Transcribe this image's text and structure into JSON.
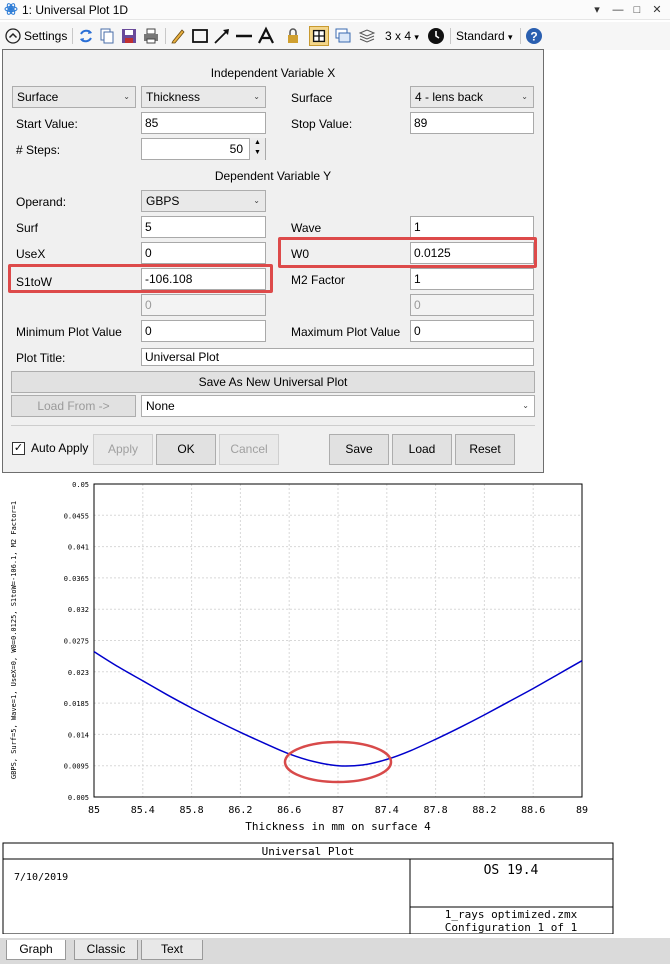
{
  "window": {
    "title": "1: Universal Plot 1D"
  },
  "toolbar": {
    "settings_label": "Settings",
    "layout_label": "3 x 4",
    "layout_caret": "▾",
    "standard_label": "Standard",
    "standard_caret": "▾"
  },
  "settings": {
    "section_x": "Independent Variable X",
    "x_type_combo": "Surface",
    "x_param_combo": "Thickness",
    "surface_label": "Surface",
    "surface_combo": "4 - lens back",
    "start_label": "Start Value:",
    "start_value": "85",
    "stop_label": "Stop Value:",
    "stop_value": "89",
    "steps_label": "# Steps:",
    "steps_value": "50",
    "section_y": "Dependent Variable Y",
    "operand_label": "Operand:",
    "operand_combo": "GBPS",
    "surf_label": "Surf",
    "surf_value": "5",
    "wave_label": "Wave",
    "wave_value": "1",
    "usex_label": "UseX",
    "usex_value": "0",
    "w0_label": "W0",
    "w0_value": "0.0125",
    "s1tow_label": "S1toW",
    "s1tow_value": "-106.108",
    "m2_label": "M2 Factor",
    "m2_value": "1",
    "extra_left_value": "0",
    "extra_right_value": "0",
    "min_label": "Minimum Plot Value",
    "min_value": "0",
    "max_label": "Maximum Plot Value",
    "max_value": "0",
    "plot_title_label": "Plot Title:",
    "plot_title_value": "Universal Plot",
    "save_as_new": "Save As New Universal Plot",
    "load_from": "Load From ->",
    "load_combo": "None",
    "auto_apply_label": "Auto Apply",
    "auto_apply_checked": "✓",
    "apply_button": "Apply",
    "ok_button": "OK",
    "cancel_button": "Cancel",
    "save_button": "Save",
    "load_button": "Load",
    "reset_button": "Reset"
  },
  "chart_data": {
    "type": "line",
    "xlabel": "Thickness in mm on surface 4",
    "ylabel": "GBPS, Surf=5, Wave=1, UseX=0, W0=0.0125, S1toW=-106.1, M2 Factor=1",
    "xlim": [
      85,
      89
    ],
    "ylim": [
      0.005,
      0.05
    ],
    "x_ticks": [
      "85",
      "85.4",
      "85.8",
      "86.2",
      "86.6",
      "87",
      "87.4",
      "87.8",
      "88.2",
      "88.6",
      "89"
    ],
    "y_ticks": [
      "0.005",
      "0.0095",
      "0.014",
      "0.0185",
      "0.023",
      "0.0275",
      "0.032",
      "0.0365",
      "0.041",
      "0.0455",
      "0.05"
    ],
    "grid": true,
    "line_color": "#0000cc",
    "annotation_color": "#d84a4a",
    "series": [
      {
        "x": [
          85,
          85.2,
          85.4,
          85.6,
          85.8,
          86.0,
          86.2,
          86.4,
          86.6,
          86.8,
          87.0,
          87.2,
          87.4,
          87.6,
          87.8,
          88.0,
          88.2,
          88.4,
          88.6,
          88.8,
          89.0
        ],
        "values": [
          0.0259,
          0.0237,
          0.0217,
          0.0197,
          0.0178,
          0.016,
          0.0143,
          0.0127,
          0.0112,
          0.0101,
          0.0095,
          0.0096,
          0.0104,
          0.0117,
          0.0133,
          0.015,
          0.0168,
          0.0187,
          0.0206,
          0.0226,
          0.0246
        ]
      }
    ]
  },
  "footer": {
    "title": "Universal Plot",
    "date": "7/10/2019",
    "version": "OS 19.4",
    "file": "1_rays optimized.zmx",
    "config": "Configuration 1 of 1"
  },
  "tabs": [
    "Graph",
    "Classic",
    "Text"
  ]
}
